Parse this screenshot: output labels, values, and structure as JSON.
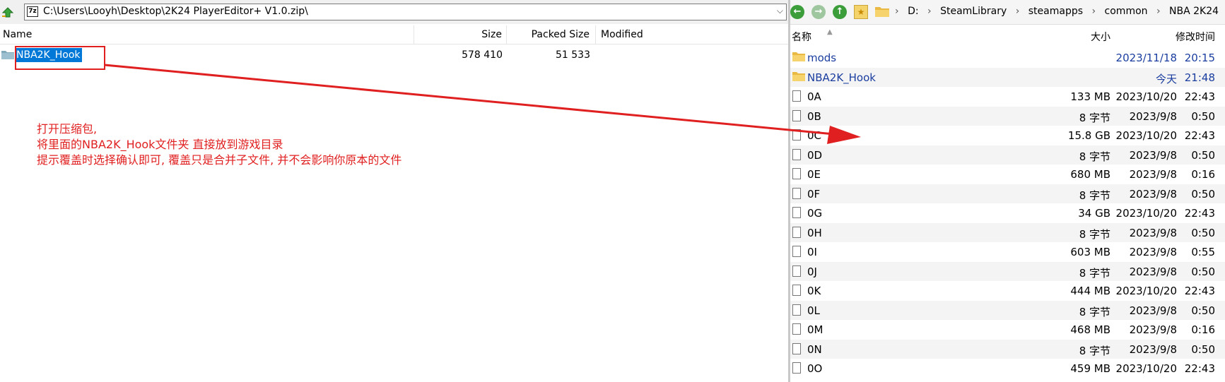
{
  "left": {
    "address_path": "C:\\Users\\Looyh\\Desktop\\2K24 PlayerEditor+ V1.0.zip\\",
    "zip_badge": "7z",
    "columns": {
      "name": "Name",
      "size": "Size",
      "packed": "Packed Size",
      "modified": "Modified"
    },
    "rows": [
      {
        "name": "NBA2K_Hook",
        "size": "578 410",
        "packed": "51 533",
        "modified": ""
      }
    ],
    "annotation": [
      "打开压缩包,",
      "将里面的NBA2K_Hook文件夹 直接放到游戏目录",
      "提示覆盖时选择确认即可, 覆盖只是合并子文件, 并不会影响你原本的文件"
    ],
    "annotation_color": "#e02020"
  },
  "right": {
    "breadcrumb": [
      "D:",
      "SteamLibrary",
      "steamapps",
      "common",
      "NBA 2K24"
    ],
    "columns": {
      "name": "名称",
      "size": "大小",
      "modified": "修改时间"
    },
    "items": [
      {
        "name": "mods",
        "type": "folder",
        "size": "",
        "date": "2023/11/18",
        "time": "20:15"
      },
      {
        "name": "NBA2K_Hook",
        "type": "folder",
        "size": "",
        "date": "今天",
        "time": "21:48"
      },
      {
        "name": "0A",
        "type": "file",
        "size": "133 MB",
        "date": "2023/10/20",
        "time": "22:43"
      },
      {
        "name": "0B",
        "type": "file",
        "size": "8 字节",
        "date": "2023/9/8",
        "time": "0:50"
      },
      {
        "name": "0C",
        "type": "file",
        "size": "15.8 GB",
        "date": "2023/10/20",
        "time": "22:43"
      },
      {
        "name": "0D",
        "type": "file",
        "size": "8 字节",
        "date": "2023/9/8",
        "time": "0:50"
      },
      {
        "name": "0E",
        "type": "file",
        "size": "680 MB",
        "date": "2023/9/8",
        "time": "0:16"
      },
      {
        "name": "0F",
        "type": "file",
        "size": "8 字节",
        "date": "2023/9/8",
        "time": "0:50"
      },
      {
        "name": "0G",
        "type": "file",
        "size": "34 GB",
        "date": "2023/10/20",
        "time": "22:43"
      },
      {
        "name": "0H",
        "type": "file",
        "size": "8 字节",
        "date": "2023/9/8",
        "time": "0:50"
      },
      {
        "name": "0I",
        "type": "file",
        "size": "603 MB",
        "date": "2023/9/8",
        "time": "0:55"
      },
      {
        "name": "0J",
        "type": "file",
        "size": "8 字节",
        "date": "2023/9/8",
        "time": "0:50"
      },
      {
        "name": "0K",
        "type": "file",
        "size": "444 MB",
        "date": "2023/10/20",
        "time": "22:43"
      },
      {
        "name": "0L",
        "type": "file",
        "size": "8 字节",
        "date": "2023/9/8",
        "time": "0:50"
      },
      {
        "name": "0M",
        "type": "file",
        "size": "468 MB",
        "date": "2023/9/8",
        "time": "0:16"
      },
      {
        "name": "0N",
        "type": "file",
        "size": "8 字节",
        "date": "2023/9/8",
        "time": "0:50"
      },
      {
        "name": "0O",
        "type": "file",
        "size": "459 MB",
        "date": "2023/10/20",
        "time": "22:43"
      }
    ]
  },
  "colors": {
    "selection": "#0078d7",
    "folder": "#e9b942",
    "annotation_red": "#e02020",
    "link_blue": "#1a3d9f"
  },
  "icons": {
    "up": "green-up-arrow-icon",
    "back": "back-arrow-icon",
    "forward": "forward-arrow-icon",
    "parent": "up-arrow-icon",
    "favorite": "star-icon"
  }
}
